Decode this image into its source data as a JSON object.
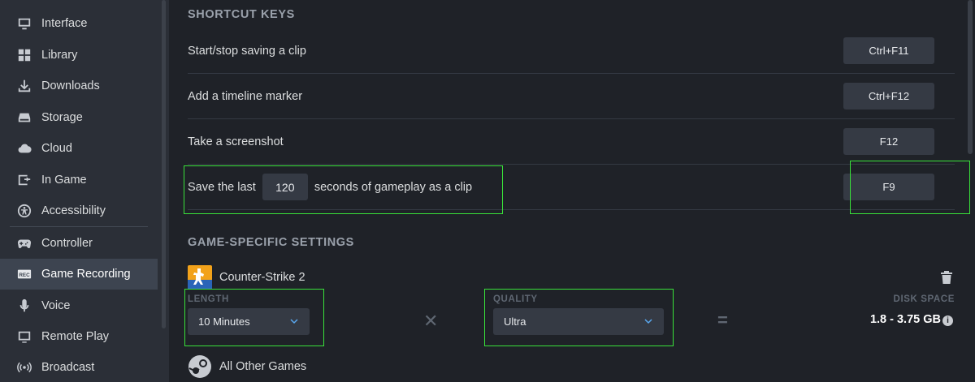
{
  "sidebar": {
    "items": [
      {
        "label": "Interface",
        "icon": "monitor-icon"
      },
      {
        "label": "Library",
        "icon": "grid-icon"
      },
      {
        "label": "Downloads",
        "icon": "download-icon"
      },
      {
        "label": "Storage",
        "icon": "storage-icon"
      },
      {
        "label": "Cloud",
        "icon": "cloud-icon"
      },
      {
        "label": "In Game",
        "icon": "in-game-icon"
      },
      {
        "label": "Accessibility",
        "icon": "accessibility-icon"
      },
      {
        "label": "Controller",
        "icon": "controller-icon"
      },
      {
        "label": "Game Recording",
        "icon": "rec-icon",
        "active": true
      },
      {
        "label": "Voice",
        "icon": "microphone-icon"
      },
      {
        "label": "Remote Play",
        "icon": "remote-play-icon"
      },
      {
        "label": "Broadcast",
        "icon": "broadcast-icon"
      }
    ]
  },
  "shortcuts": {
    "title": "SHORTCUT KEYS",
    "rows": [
      {
        "label": "Start/stop saving a clip",
        "key": "Ctrl+F11"
      },
      {
        "label": "Add a timeline marker",
        "key": "Ctrl+F12"
      },
      {
        "label": "Take a screenshot",
        "key": "F12"
      }
    ],
    "clip": {
      "prefix": "Save the last",
      "seconds": "120",
      "suffix": "seconds of gameplay as a clip",
      "key": "F9"
    }
  },
  "game_settings": {
    "title": "GAME-SPECIFIC SETTINGS",
    "game_name": "Counter-Strike 2",
    "length_label": "LENGTH",
    "length_value": "10 Minutes",
    "quality_label": "QUALITY",
    "quality_value": "Ultra",
    "disk_label": "DISK SPACE",
    "disk_value": "1.8 - 3.75 GB",
    "times_symbol": "✕",
    "equals_symbol": "=",
    "other_games": "All Other Games"
  },
  "colors": {
    "highlight": "#39e23a",
    "background": "#1f2228",
    "sidebar": "#2b2f37"
  }
}
